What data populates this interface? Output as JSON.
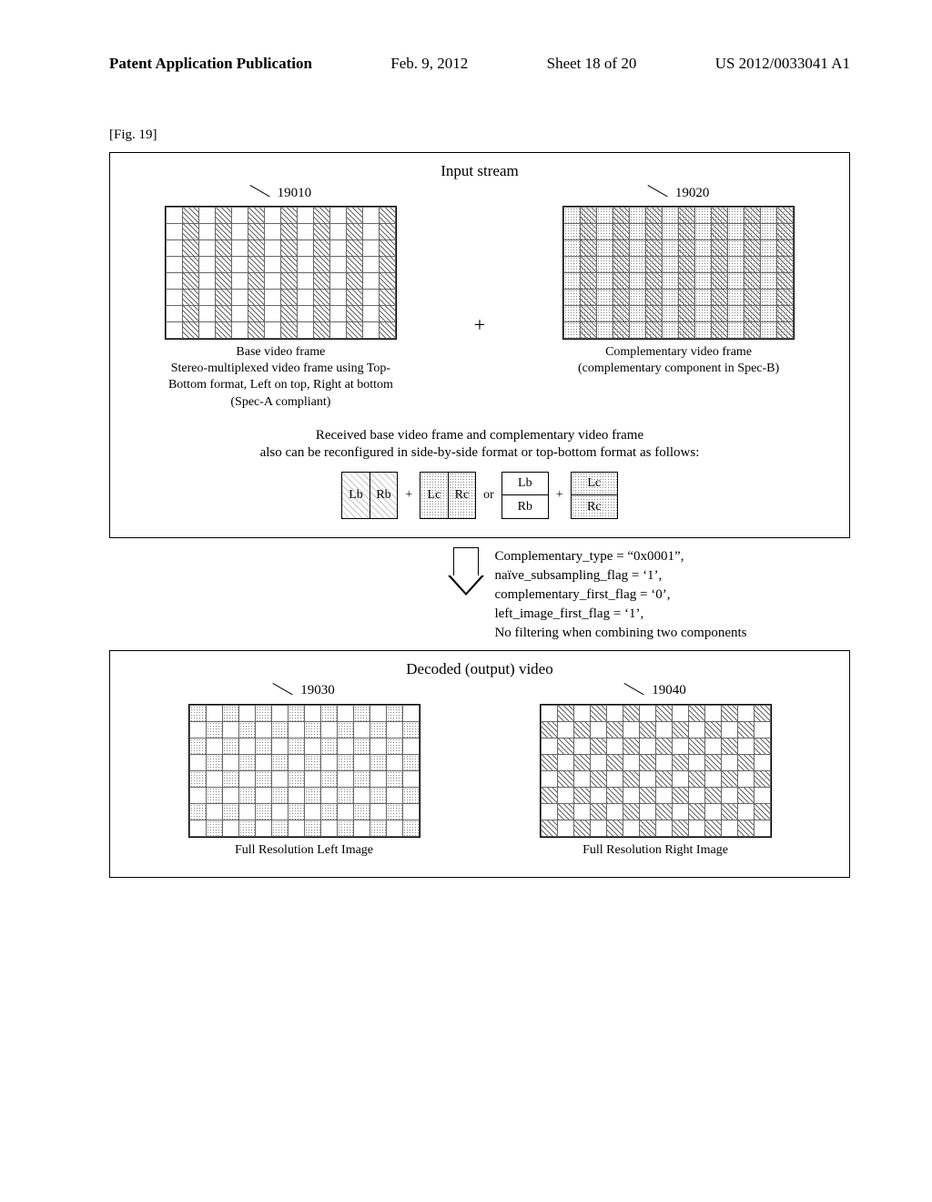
{
  "header": {
    "left": "Patent Application Publication",
    "date": "Feb. 9, 2012",
    "sheet": "Sheet 18 of 20",
    "pubno": "US 2012/0033041 A1"
  },
  "figure_label": "[Fig. 19]",
  "input": {
    "title": "Input stream",
    "ref_left": "19010",
    "ref_right": "19020",
    "caption_left_l1": "Base video frame",
    "caption_left_l2": "Stereo-multiplexed video frame using Top-",
    "caption_left_l3": "Bottom format, Left on top, Right at bottom",
    "caption_left_l4": "(Spec-A compliant)",
    "caption_right_l1": "Complementary video frame",
    "caption_right_l2": "(complementary component in Spec-B)",
    "plus": "+"
  },
  "reconfig": {
    "line1": "Received base video frame and complementary video frame",
    "line2": "also can be reconfigured in side-by-side format or top-bottom format as follows:",
    "Lb": "Lb",
    "Rb": "Rb",
    "Lc": "Lc",
    "Rc": "Rc",
    "plus": "+",
    "or": "or"
  },
  "params": {
    "l1": "Complementary_type = “0x0001”,",
    "l2": "naïve_subsampling_flag = ‘1’,",
    "l3": "complementary_first_flag = ‘0’,",
    "l4": "left_image_first_flag = ‘1’,",
    "l5": "No filtering when combining two components"
  },
  "output": {
    "title": "Decoded (output) video",
    "ref_left": "19030",
    "ref_right": "19040",
    "caption_left": "Full Resolution Left Image",
    "caption_right": "Full Resolution Right Image"
  }
}
